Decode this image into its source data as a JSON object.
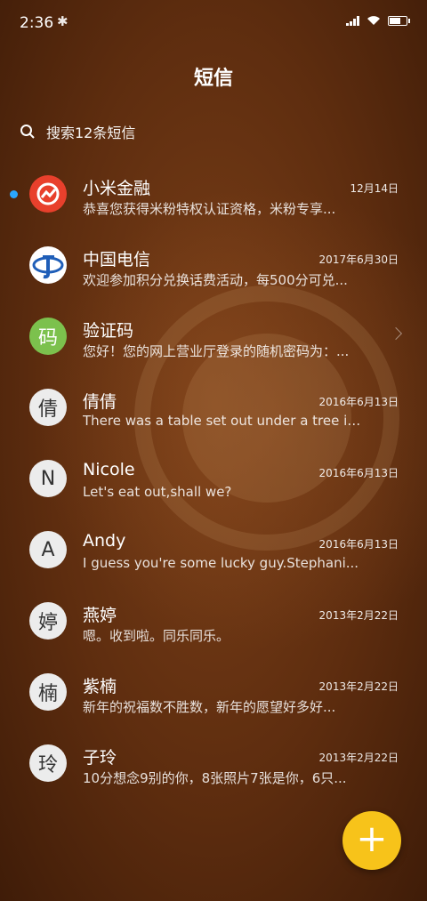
{
  "status_bar": {
    "time": "2:36"
  },
  "header": {
    "title": "短信"
  },
  "search": {
    "placeholder": "搜索12条短信"
  },
  "colors": {
    "accent_fab": "#f7c31a",
    "unread_dot": "#2aa7ff"
  },
  "messages": [
    {
      "name": "小米金融",
      "date": "12月14日",
      "preview": "恭喜您获得米粉特权认证资格，米粉专享...",
      "avatar_icon": "xiaomi-finance-logo-icon",
      "avatar_text": "",
      "unread": true
    },
    {
      "name": "中国电信",
      "date": "2017年6月30日",
      "preview": "欢迎参加积分兑换话费活动，每500分可兑...",
      "avatar_icon": "china-telecom-logo-icon",
      "avatar_text": ""
    },
    {
      "name": "验证码",
      "date": "",
      "preview": "您好！您的网上营业厅登录的随机密码为：...",
      "avatar_text": "码",
      "has_chevron": true
    },
    {
      "name": "倩倩",
      "date": "2016年6月13日",
      "preview": "There was a table set out under a tree in...",
      "avatar_text": "倩"
    },
    {
      "name": "Nicole",
      "date": "2016年6月13日",
      "preview": "Let's eat out,shall we?",
      "avatar_text": "N"
    },
    {
      "name": "Andy",
      "date": "2016年6月13日",
      "preview": "I guess you're some lucky guy.Stephani...",
      "avatar_text": "A"
    },
    {
      "name": "燕婷",
      "date": "2013年2月22日",
      "preview": "嗯。收到啦。同乐同乐。",
      "avatar_text": "婷"
    },
    {
      "name": "紫楠",
      "date": "2013年2月22日",
      "preview": "新年的祝福数不胜数，新年的愿望好多好...",
      "avatar_text": "楠"
    },
    {
      "name": "子玲",
      "date": "2013年2月22日",
      "preview": "10分想念9别的你，8张照片7张是你，6只...",
      "avatar_text": "玲"
    }
  ],
  "fab": {
    "label": "+"
  }
}
